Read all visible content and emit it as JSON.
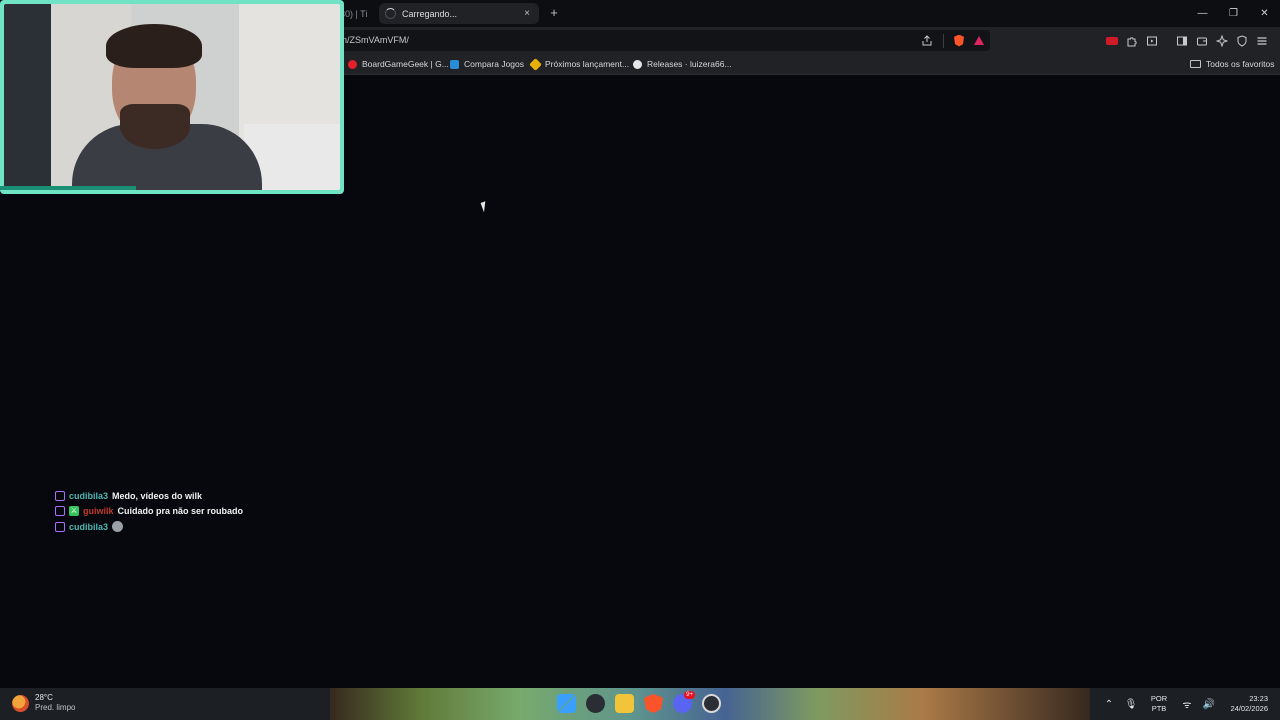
{
  "browser": {
    "tabs": [
      {
        "label": "30) | Ti"
      },
      {
        "label": "Carregando..."
      }
    ],
    "new_tab_label": "+",
    "close_tab_label": "×",
    "window_controls": {
      "minimize": "—",
      "restore": "❐",
      "close": "✕"
    },
    "url": "n/ZSmVAmVFM/",
    "bookmarks": [
      {
        "label": "BoardGameGeek | G...",
        "color": "#e3212b"
      },
      {
        "label": "Compara Jogos",
        "color": "#2a8bd6"
      },
      {
        "label": "Próximos lançament...",
        "color": "#e7b008"
      },
      {
        "label": "Releases · luizera66...",
        "color": "#e6e6e6"
      }
    ],
    "bookmarks_folder": "Todos os favoritos"
  },
  "chat": {
    "messages": [
      {
        "user": "cudibila3",
        "text": "Medo, vídeos do wilk"
      },
      {
        "user": "guiwilk",
        "text": "Cuidado pra não ser roubado"
      },
      {
        "user": "cudibila3",
        "text": ""
      }
    ]
  },
  "taskbar": {
    "weather": {
      "temp": "28°C",
      "desc": "Pred. limpo"
    },
    "language": {
      "line1": "POR",
      "line2": "PTB"
    },
    "clock": {
      "time": "23:23",
      "date": "24/02/2026"
    },
    "discord_badge": "9+"
  },
  "colors": {
    "accent_webcam": "#6fe3c3",
    "page_bg": "#06080d",
    "chat_user_teal": "#4fb5b0",
    "chat_user_red": "#c0392b"
  }
}
